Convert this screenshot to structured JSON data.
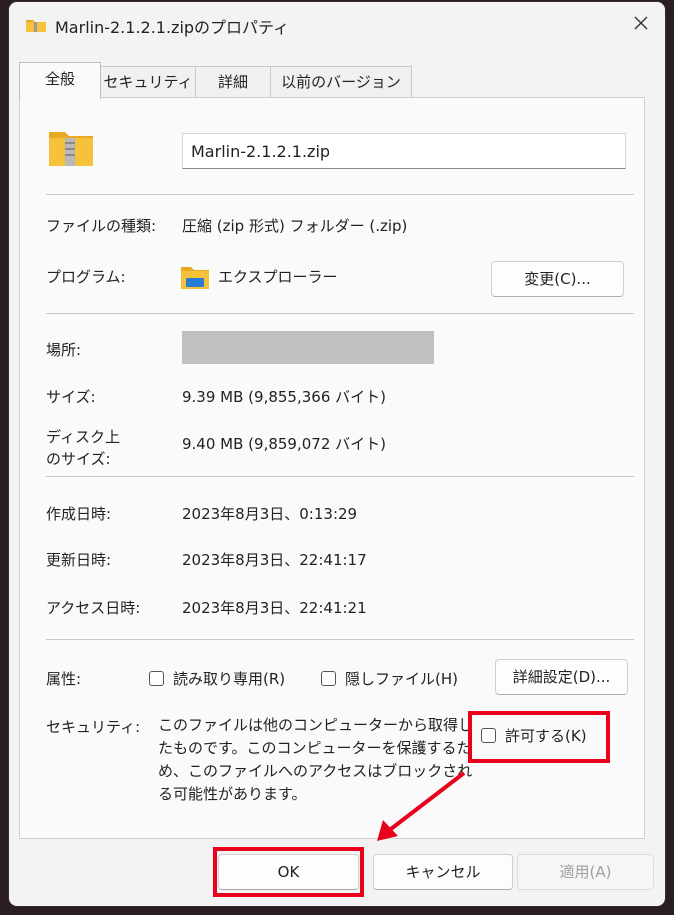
{
  "window": {
    "title": "Marlin-2.1.2.1.zipのプロパティ"
  },
  "tabs": [
    {
      "label": "全般",
      "active": true
    },
    {
      "label": "セキュリティ",
      "active": false
    },
    {
      "label": "詳細",
      "active": false
    },
    {
      "label": "以前のバージョン",
      "active": false
    }
  ],
  "general": {
    "file_name": "Marlin-2.1.2.1.zip",
    "file_type_label": "ファイルの種類:",
    "file_type_value": "圧縮 (zip 形式) フォルダー (.zip)",
    "program_label": "プログラム:",
    "program_value": "エクスプローラー",
    "change_button": "変更(C)...",
    "location_label": "場所:",
    "size_label": "サイズ:",
    "size_value": "9.39 MB (9,855,366 バイト)",
    "disk_size_label_line1": "ディスク上",
    "disk_size_label_line2": "のサイズ:",
    "disk_size_value": "9.40 MB (9,859,072 バイト)",
    "created_label": "作成日時:",
    "created_value": "2023年8月3日、0:13:29",
    "modified_label": "更新日時:",
    "modified_value": "2023年8月3日、22:41:17",
    "accessed_label": "アクセス日時:",
    "accessed_value": "2023年8月3日、22:41:21",
    "attributes_label": "属性:",
    "readonly_label": "読み取り専用(R)",
    "hidden_label": "隠しファイル(H)",
    "advanced_button": "詳細設定(D)...",
    "security_label": "セキュリティ:",
    "security_text": "このファイルは他のコンピューターから取得したものです。このコンピューターを保護するため、このファイルへのアクセスはブロックされる可能性があります。",
    "unblock_label": "許可する(K)"
  },
  "footer": {
    "ok": "OK",
    "cancel": "キャンセル",
    "apply": "適用(A)"
  },
  "colors": {
    "highlight": "#e8001c",
    "folder": "#f6c13b"
  }
}
